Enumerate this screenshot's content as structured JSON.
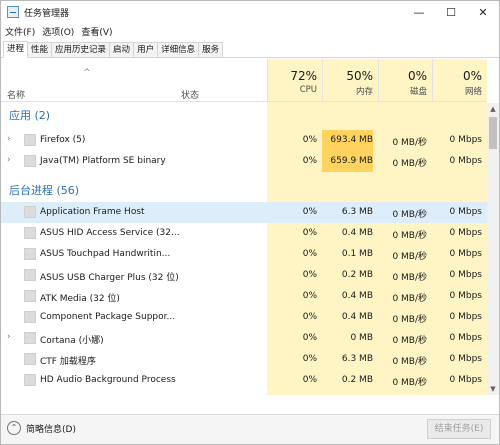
{
  "window": {
    "title": "任务管理器",
    "minimize_glyph": "—",
    "maximize_glyph": "☐",
    "close_glyph": "✕"
  },
  "menu": [
    "文件(F)",
    "选项(O)",
    "查看(V)"
  ],
  "tabs": [
    "进程",
    "性能",
    "应用历史记录",
    "启动",
    "用户",
    "详细信息",
    "服务"
  ],
  "header": {
    "name": "名称",
    "status": "状态",
    "cpu": {
      "pct": "72%",
      "label": "CPU"
    },
    "mem": {
      "pct": "50%",
      "label": "内存"
    },
    "disk": {
      "pct": "0%",
      "label": "磁盘"
    },
    "net": {
      "pct": "0%",
      "label": "网络"
    }
  },
  "groups": {
    "apps": "应用 (2)",
    "background": "后台进程 (56)"
  },
  "rows": [
    {
      "name": "Firefox (5)",
      "cpu": "0%",
      "mem": "693.4 MB",
      "disk": "0 MB/秒",
      "net": "0 Mbps"
    },
    {
      "name": "Java(TM) Platform SE binary",
      "cpu": "0%",
      "mem": "659.9 MB",
      "disk": "0 MB/秒",
      "net": "0 Mbps"
    },
    {
      "name": "Application Frame Host",
      "cpu": "0%",
      "mem": "6.3 MB",
      "disk": "0 MB/秒",
      "net": "0 Mbps"
    },
    {
      "name": "ASUS HID Access Service (32...",
      "cpu": "0%",
      "mem": "0.4 MB",
      "disk": "0 MB/秒",
      "net": "0 Mbps"
    },
    {
      "name": "ASUS Touchpad Handwritin...",
      "cpu": "0%",
      "mem": "0.1 MB",
      "disk": "0 MB/秒",
      "net": "0 Mbps"
    },
    {
      "name": "ASUS USB Charger Plus (32 位)",
      "cpu": "0%",
      "mem": "0.2 MB",
      "disk": "0 MB/秒",
      "net": "0 Mbps"
    },
    {
      "name": "ATK Media (32 位)",
      "cpu": "0%",
      "mem": "0.4 MB",
      "disk": "0 MB/秒",
      "net": "0 Mbps"
    },
    {
      "name": "Component Package Suppor...",
      "cpu": "0%",
      "mem": "0.4 MB",
      "disk": "0 MB/秒",
      "net": "0 Mbps"
    },
    {
      "name": "Cortana (小娜)",
      "cpu": "0%",
      "mem": "0 MB",
      "disk": "0 MB/秒",
      "net": "0 Mbps"
    },
    {
      "name": "CTF 加载程序",
      "cpu": "0%",
      "mem": "6.3 MB",
      "disk": "0 MB/秒",
      "net": "0 Mbps"
    },
    {
      "name": "HD Audio Background Process",
      "cpu": "0%",
      "mem": "0.2 MB",
      "disk": "0 MB/秒",
      "net": "0 Mbps"
    }
  ],
  "footer": {
    "collapse_glyph": "⌃",
    "label": "简略信息(D)",
    "end_task": "结束任务(E)"
  },
  "colors": {
    "group_heading": "#2b6fb9",
    "heat_light": "#fff4c4",
    "heat_strong": "#ffd35e",
    "selected_row": "#ddeefa"
  }
}
